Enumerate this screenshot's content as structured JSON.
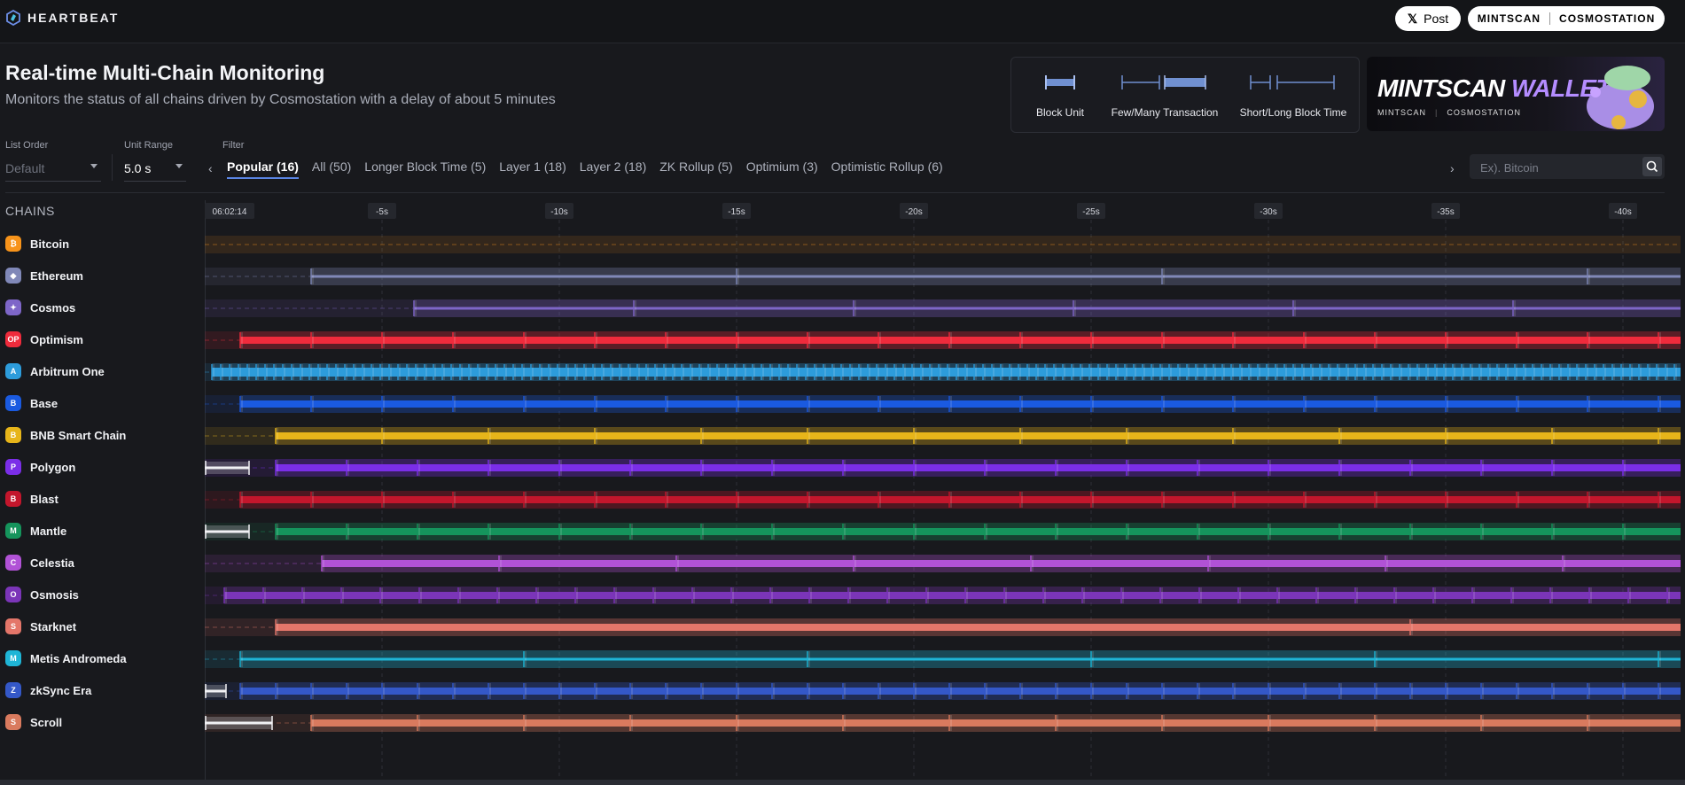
{
  "brand": {
    "name": "HEARTBEAT",
    "accent": "#5b86e5"
  },
  "topbar": {
    "x_post_label": "Post",
    "mintscan_label": "MINTSCAN",
    "cosmostation_label": "COSMOSTATION"
  },
  "header": {
    "title": "Real-time Multi-Chain Monitoring",
    "subtitle": "Monitors the status of all chains driven by Cosmostation with a delay of about 5 minutes"
  },
  "legend": {
    "block_unit": "Block Unit",
    "transactions": "Few/Many Transaction",
    "block_time": "Short/Long Block Time"
  },
  "ad": {
    "title_main": "MINTSCAN",
    "title_accent": "WALLET",
    "logo1": "MINTSCAN",
    "logo2": "COSMOSTATION"
  },
  "controls": {
    "list_order_label": "List Order",
    "list_order_value": "Default",
    "unit_range_label": "Unit Range",
    "unit_range_value": "5.0 s",
    "filter_label": "Filter"
  },
  "filters": [
    {
      "label": "Popular",
      "count": "(16)"
    },
    {
      "label": "All",
      "count": "(50)"
    },
    {
      "label": "Longer Block Time",
      "count": "(5)"
    },
    {
      "label": "Layer 1",
      "count": "(18)"
    },
    {
      "label": "Layer 2",
      "count": "(18)"
    },
    {
      "label": "ZK Rollup",
      "count": "(5)"
    },
    {
      "label": "Optimium",
      "count": "(3)"
    },
    {
      "label": "Optimistic Rollup",
      "count": "(6)"
    }
  ],
  "search": {
    "placeholder": "Ex). Bitcoin"
  },
  "chains_title": "CHAINS",
  "timeline": {
    "ticks": [
      "06:02:14",
      "-5s",
      "-10s",
      "-15s",
      "-20s",
      "-25s",
      "-30s",
      "-35s",
      "-40s"
    ],
    "seconds_span": 41.6
  },
  "chains": [
    {
      "name": "Bitcoin",
      "color": "#f7931a",
      "icon": "bitcoin-icon",
      "glyph": "₿",
      "start": 1000000000.0,
      "interval": 600,
      "pending": 0
    },
    {
      "name": "Ethereum",
      "color": "#8088b8",
      "icon": "ethereum-icon",
      "glyph": "◆",
      "start": 3,
      "interval": 12,
      "pending": 0
    },
    {
      "name": "Cosmos",
      "color": "#7e66c8",
      "icon": "cosmos-icon",
      "glyph": "✦",
      "start": 5.9,
      "interval": 6.2,
      "pending": 0
    },
    {
      "name": "Optimism",
      "color": "#ef2b3c",
      "icon": "optimism-icon",
      "glyph": "OP",
      "start": 1,
      "interval": 2,
      "pending": 0
    },
    {
      "name": "Arbitrum One",
      "color": "#2d9cdb",
      "icon": "arbitrum-icon",
      "glyph": "A",
      "start": 0.2,
      "interval": 0.25,
      "pending": 0
    },
    {
      "name": "Base",
      "color": "#1a5ae0",
      "icon": "base-icon",
      "glyph": "B",
      "start": 1,
      "interval": 2,
      "pending": 0
    },
    {
      "name": "BNB Smart Chain",
      "color": "#e7b51a",
      "icon": "bnb-icon",
      "glyph": "B",
      "start": 2,
      "interval": 3,
      "pending": 0
    },
    {
      "name": "Polygon",
      "color": "#7b2ee8",
      "icon": "polygon-icon",
      "glyph": "P",
      "start": 2,
      "interval": 2,
      "pending": 1.25
    },
    {
      "name": "Blast",
      "color": "#c3162c",
      "icon": "blast-icon",
      "glyph": "B",
      "start": 1,
      "interval": 2,
      "pending": 0
    },
    {
      "name": "Mantle",
      "color": "#15945c",
      "icon": "mantle-icon",
      "glyph": "M",
      "start": 2,
      "interval": 2,
      "pending": 1.25
    },
    {
      "name": "Celestia",
      "color": "#b152d6",
      "icon": "celestia-icon",
      "glyph": "C",
      "start": 3.3,
      "interval": 5,
      "pending": 0
    },
    {
      "name": "Osmosis",
      "color": "#7b35b8",
      "icon": "osmosis-icon",
      "glyph": "O",
      "start": 0.55,
      "interval": 1.1,
      "pending": 0
    },
    {
      "name": "Starknet",
      "color": "#e4766a",
      "icon": "starknet-icon",
      "glyph": "S",
      "start": 2,
      "interval": 32,
      "pending": 0
    },
    {
      "name": "Metis Andromeda",
      "color": "#1fb5d6",
      "icon": "metis-icon",
      "glyph": "M",
      "start": 1,
      "interval": 8,
      "pending": 0
    },
    {
      "name": "zkSync Era",
      "color": "#3458c8",
      "icon": "zksync-icon",
      "glyph": "Z",
      "start": 1,
      "interval": 1,
      "pending": 0.6
    },
    {
      "name": "Scroll",
      "color": "#d97a5e",
      "icon": "scroll-icon",
      "glyph": "S",
      "start": 3,
      "interval": 3,
      "pending": 1.9
    }
  ]
}
